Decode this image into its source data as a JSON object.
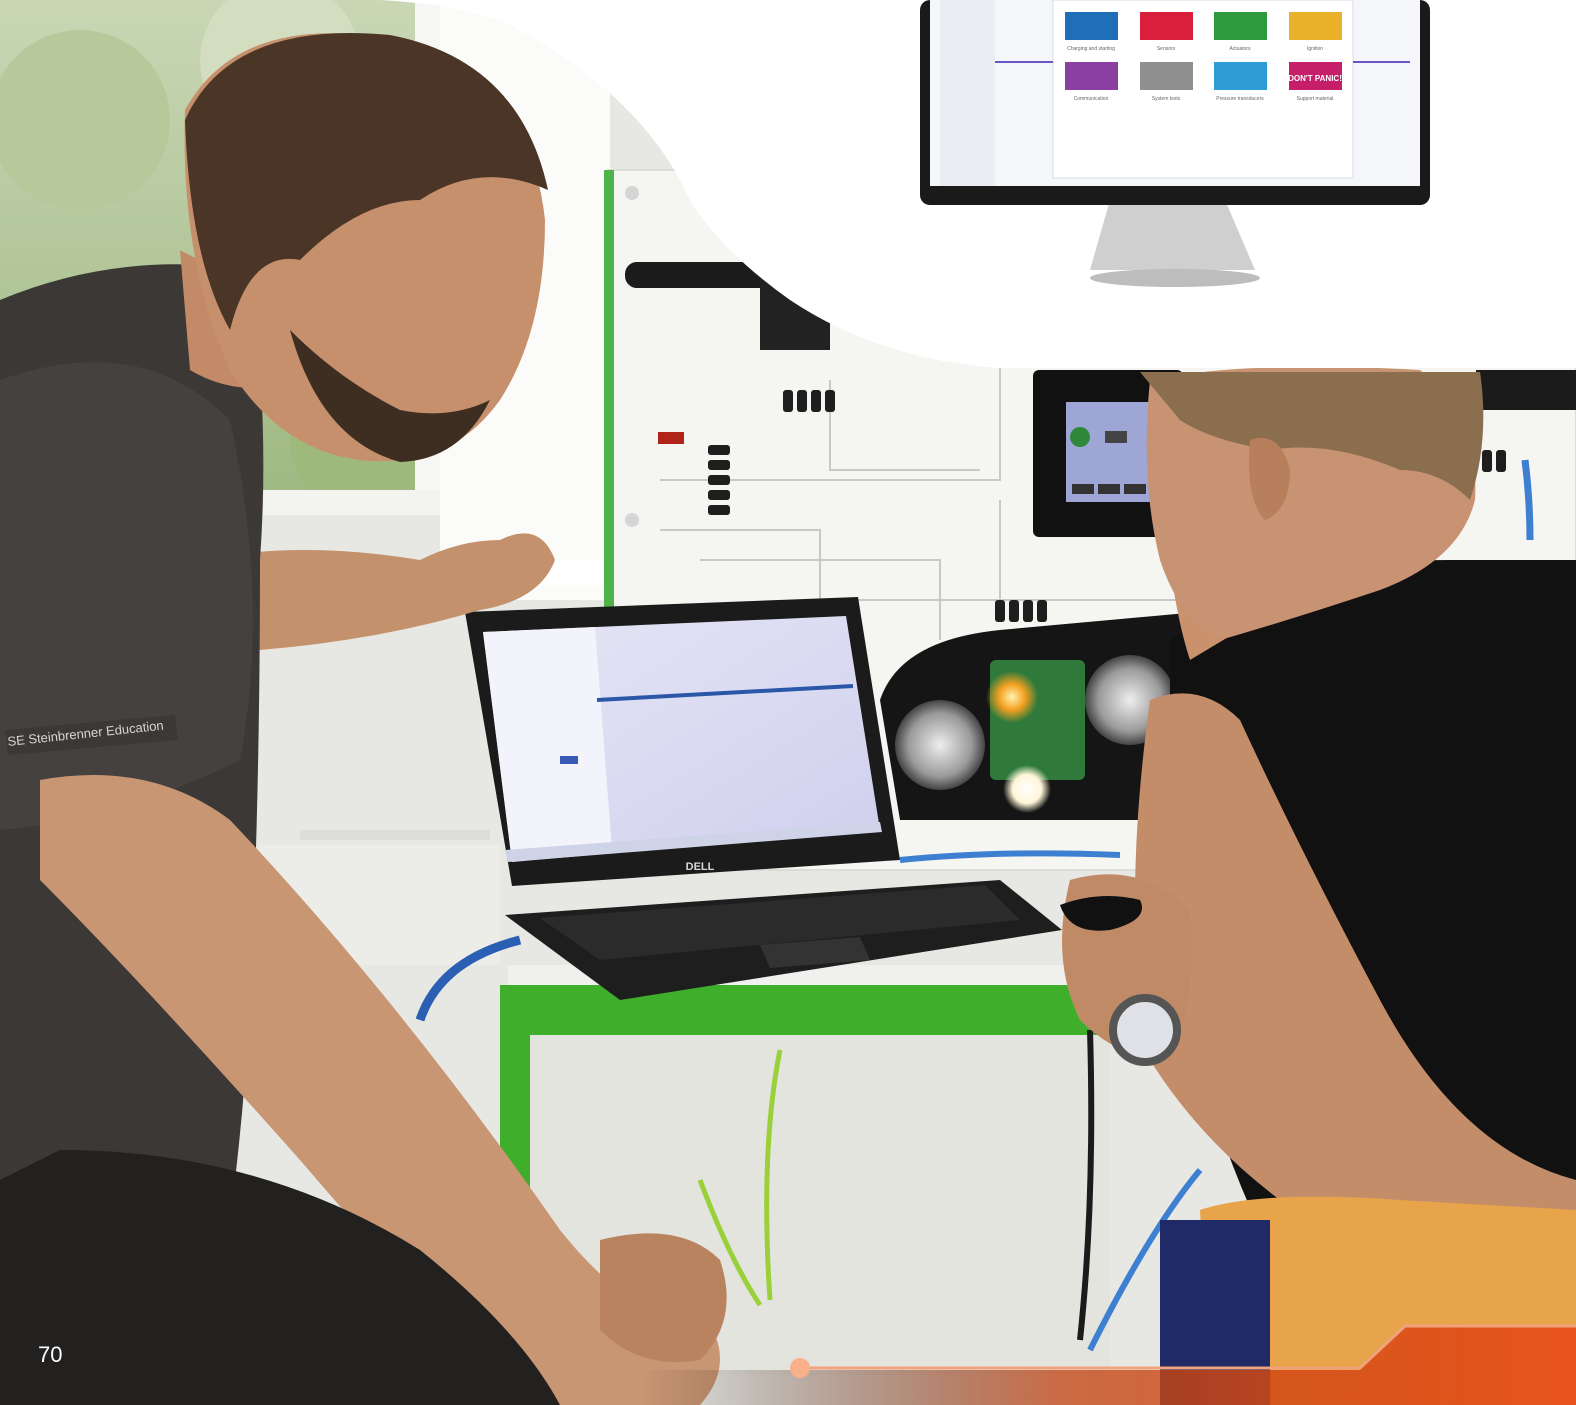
{
  "page": {
    "number": "70"
  },
  "monitor": {
    "tiles": [
      {
        "label": "Charging and starting",
        "color": "#1f6fb8"
      },
      {
        "label": "Sensors",
        "color": "#d8203d"
      },
      {
        "label": "Actuators",
        "color": "#2e9a3e"
      },
      {
        "label": "Ignition",
        "color": "#e9b22a"
      },
      {
        "label": "Communication",
        "color": "#8b3fa0"
      },
      {
        "label": "System tests",
        "color": "#8f8f8f"
      },
      {
        "label": "Pressure transducers",
        "color": "#2c9bd6"
      },
      {
        "label": "Support material",
        "color": "#c61f6a"
      }
    ],
    "dont_panic_text": "DON'T PANIC!"
  },
  "shirt_logo": {
    "text": "SE Steinbrenner Education"
  },
  "laptop": {
    "brand": "DELL"
  },
  "colors": {
    "accent_orange": "#e8541c",
    "accent_line": "#f2a27a",
    "table_green": "#3fae2a",
    "wall": "#f1f1ee"
  }
}
